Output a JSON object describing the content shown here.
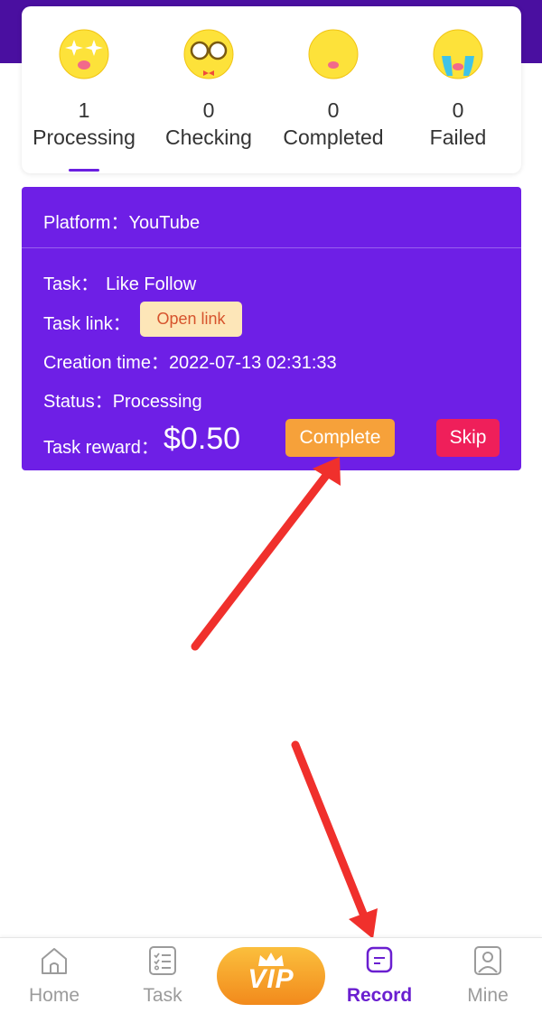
{
  "status_tabs": [
    {
      "count": "1",
      "label": "Processing",
      "icon": "starry-eyes-emoji-icon"
    },
    {
      "count": "0",
      "label": "Checking",
      "icon": "glasses-emoji-icon"
    },
    {
      "count": "0",
      "label": "Completed",
      "icon": "smiling-emoji-icon"
    },
    {
      "count": "0",
      "label": "Failed",
      "icon": "crying-emoji-icon"
    }
  ],
  "active_tab": "Processing",
  "task": {
    "platform_label": "Platform：",
    "platform": "YouTube",
    "task_label": "Task：",
    "task_value": "Like Follow",
    "link_label": "Task link：",
    "open_link": "Open link",
    "created_label": "Creation time：",
    "created": "2022-07-13 02:31:33",
    "status_label": "Status：",
    "status": "Processing",
    "reward_label": "Task reward：",
    "reward": "$0.50",
    "complete": "Complete",
    "skip": "Skip"
  },
  "nav": {
    "home": "Home",
    "task": "Task",
    "vip": "VIP",
    "record": "Record",
    "mine": "Mine",
    "active": "Record"
  },
  "colors": {
    "brand_purple": "#6e1fe6",
    "header_purple": "#4a0fa0",
    "complete_orange": "#f6a13a",
    "skip_red": "#ef1f5a",
    "annotation_red": "#f0302c"
  }
}
